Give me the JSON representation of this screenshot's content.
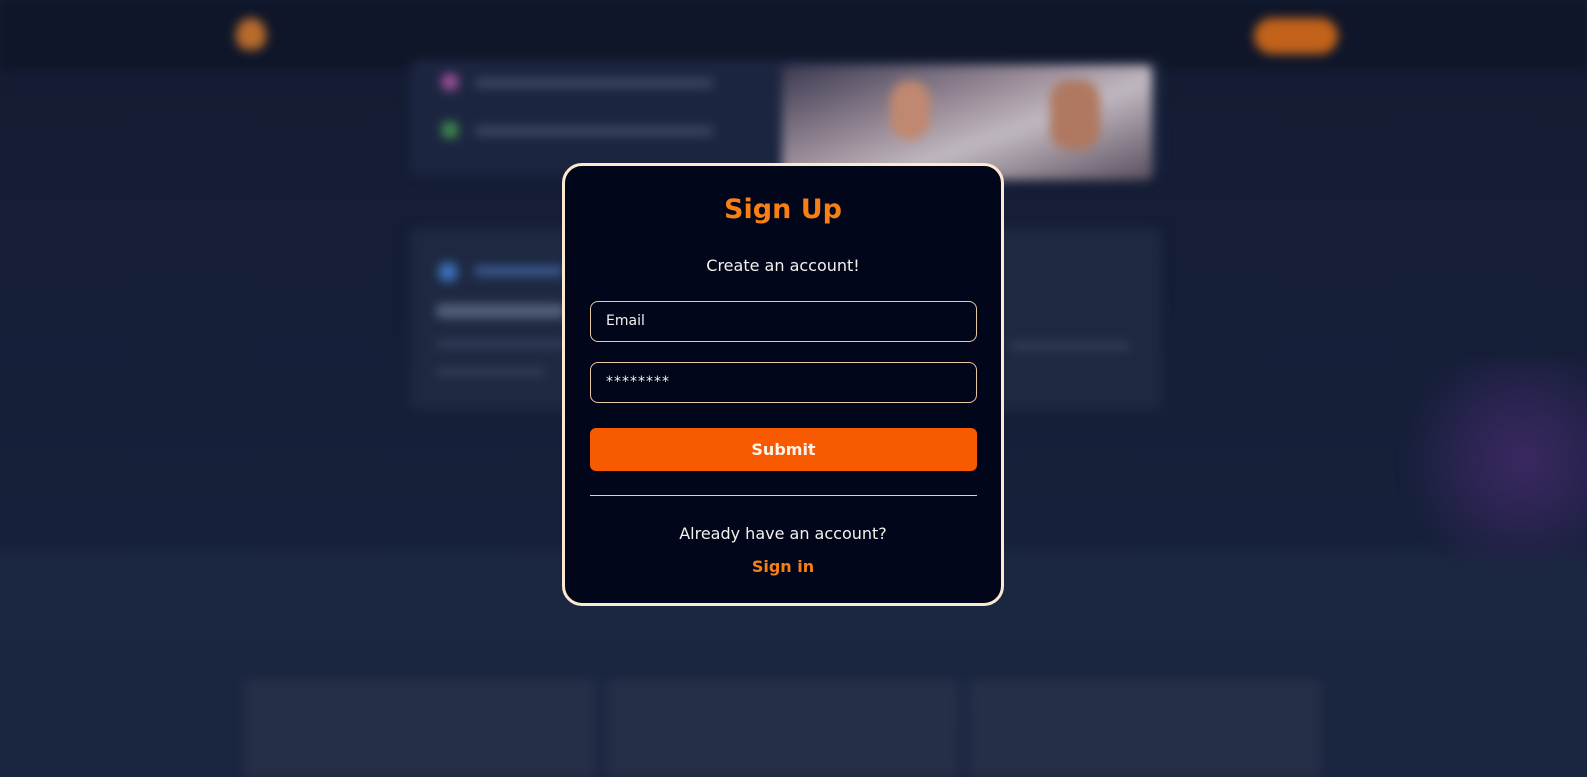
{
  "modal": {
    "title": "Sign Up",
    "subtitle": "Create an account!",
    "email_placeholder": "Email",
    "password_value": "********",
    "submit_label": "Submit",
    "already_text": "Already have an account?",
    "signin_label": "Sign in"
  },
  "colors": {
    "accent": "#f77f14",
    "submit_button": "#f75a00",
    "modal_background": "#02061a",
    "modal_border": "#fde9cf"
  },
  "background_icons": [
    "logo-icon",
    "rocket-icon"
  ]
}
